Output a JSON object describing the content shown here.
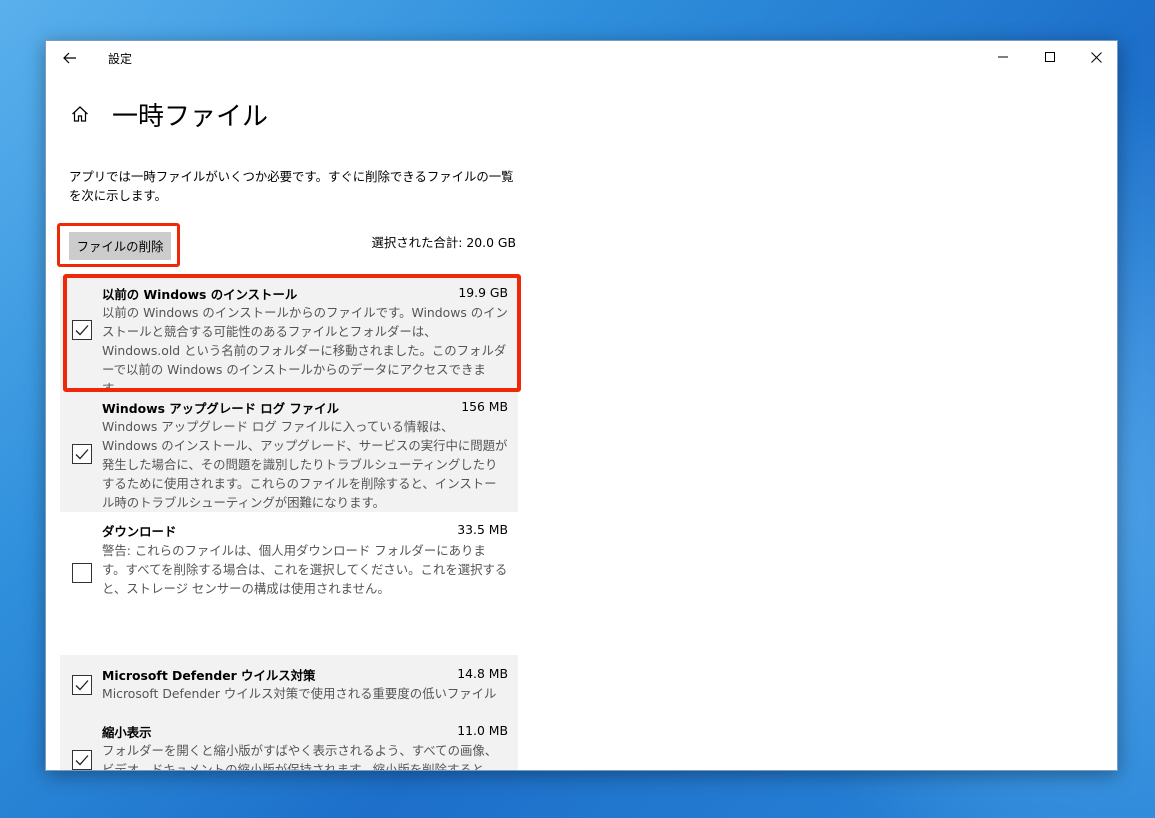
{
  "window": {
    "title": "設定"
  },
  "page": {
    "title": "一時ファイル",
    "description": "アプリでは一時ファイルがいくつか必要です。すぐに削除できるファイルの一覧を次に示します。",
    "delete_button": "ファイルの削除",
    "total": "選択された合計: 20.0 GB"
  },
  "items": [
    {
      "title": "以前の Windows のインストール",
      "size": "19.9 GB",
      "description": "以前の Windows のインストールからのファイルです。Windows のインストールと競合する可能性のあるファイルとフォルダーは、Windows.old という名前のフォルダーに移動されました。このフォルダーで以前の Windows のインストールからのデータにアクセスできます。",
      "checked": true
    },
    {
      "title": "Windows アップグレード ログ ファイル",
      "size": "156 MB",
      "description": "Windows アップグレード ログ ファイルに入っている情報は、Windows のインストール、アップグレード、サービスの実行中に問題が発生した場合に、その問題を識別したりトラブルシューティングしたりするために使用されます。これらのファイルを削除すると、インストール時のトラブルシューティングが困難になります。",
      "checked": true
    },
    {
      "title": "ダウンロード",
      "size": "33.5 MB",
      "description": "警告: これらのファイルは、個人用ダウンロード フォルダーにあります。すべてを削除する場合は、これを選択してください。これを選択すると、ストレージ センサーの構成は使用されません。",
      "checked": false
    },
    {
      "title": "Microsoft Defender ウイルス対策",
      "size": "14.8 MB",
      "description": "Microsoft Defender ウイルス対策で使用される重要度の低いファイル",
      "checked": true
    },
    {
      "title": "縮小表示",
      "size": "11.0 MB",
      "description": "フォルダーを開くと縮小版がすばやく表示されるよう、すべての画像、ビデオ、ドキュメントの縮小版が保持されます。縮小版を削除すると、必要に応じて自動的に再作成されます。",
      "checked": true
    }
  ],
  "icons": {
    "back": "back-arrow-icon",
    "home": "home-icon",
    "minimize": "minimize-icon",
    "maximize": "maximize-icon",
    "close": "close-icon",
    "checkmark": "checkmark-icon"
  },
  "colors": {
    "highlight": "#f0280a",
    "item_background": "#f2f2f2",
    "button_background": "#cccccc",
    "desktop": "#1d6fc9"
  }
}
